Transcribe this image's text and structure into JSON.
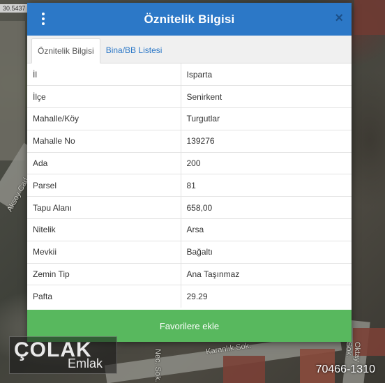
{
  "map": {
    "coordinate": "30.5437",
    "street_labels": [
      "Aksoy Cad.",
      "Karanlık Sok.",
      "Oktay Sok.",
      "Nec. Sok."
    ]
  },
  "modal": {
    "title": "Öznitelik Bilgisi",
    "close_label": "×",
    "tabs": [
      {
        "label": "Öznitelik Bilgisi",
        "active": true
      },
      {
        "label": "Bina/BB Listesi",
        "active": false
      }
    ],
    "rows": [
      {
        "key": "İl",
        "value": "Isparta"
      },
      {
        "key": "İlçe",
        "value": "Senirkent"
      },
      {
        "key": "Mahalle/Köy",
        "value": "Turgutlar"
      },
      {
        "key": "Mahalle No",
        "value": "139276"
      },
      {
        "key": "Ada",
        "value": "200"
      },
      {
        "key": "Parsel",
        "value": "81"
      },
      {
        "key": "Tapu Alanı",
        "value": "658,00"
      },
      {
        "key": "Nitelik",
        "value": "Arsa"
      },
      {
        "key": "Mevkii",
        "value": "Bağaltı"
      },
      {
        "key": "Zemin Tip",
        "value": "Ana Taşınmaz"
      },
      {
        "key": "Pafta",
        "value": "29.29"
      }
    ],
    "favorite_button": "Favorilere ekle"
  },
  "watermark": {
    "brand": "ÇOLAK",
    "sub": "Emlak",
    "listing_number": "70466-1310"
  },
  "colors": {
    "header": "#2c78c7",
    "favorite_button": "#58b85e"
  }
}
